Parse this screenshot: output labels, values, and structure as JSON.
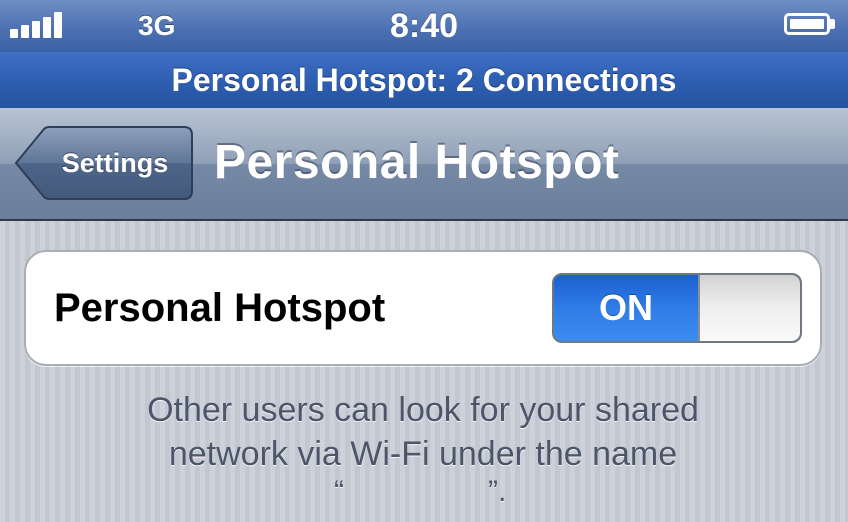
{
  "status_bar": {
    "signal_icon": "signal-bars-icon",
    "network": "3G",
    "time": "8:40",
    "battery_icon": "battery-full-icon"
  },
  "hotspot_banner": {
    "text": "Personal Hotspot: 2 Connections"
  },
  "nav_bar": {
    "back_label": "Settings",
    "title": "Personal Hotspot"
  },
  "settings": {
    "hotspot_row": {
      "label": "Personal Hotspot",
      "toggle_label": "ON"
    }
  },
  "footer": {
    "line1": "Other users can look for your shared",
    "line2": "network via Wi-Fi under the name",
    "quote_open": "“",
    "quote_close": "”."
  },
  "colors": {
    "status_bar_blue": "#4d71b2",
    "banner_blue": "#2f5fb2",
    "toggle_blue": "#2f7de6",
    "nav_gray": "#7689a4",
    "footer_text": "#4c566a"
  }
}
